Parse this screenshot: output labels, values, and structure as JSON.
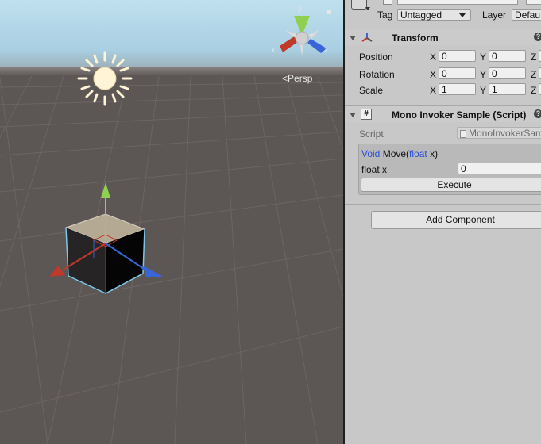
{
  "scene": {
    "gizmo_axis_labels": {
      "y": "y",
      "x": "x",
      "z": "z"
    },
    "persp_label": "Persp",
    "colors": {
      "sky": "#a9cfe2",
      "ground": "#5c5655",
      "x_axis": "#c0392b",
      "y_axis": "#8fd14f",
      "z_axis": "#3866d9"
    }
  },
  "inspector": {
    "tag_label": "Tag",
    "tag_value": "Untagged",
    "layer_label": "Layer",
    "layer_value": "Defau",
    "transform": {
      "title": "Transform",
      "help_glyph": "?",
      "rows": [
        {
          "label": "Position",
          "x_label": "X",
          "x": "0",
          "y_label": "Y",
          "y": "0",
          "z_label": "Z"
        },
        {
          "label": "Rotation",
          "x_label": "X",
          "x": "0",
          "y_label": "Y",
          "y": "0",
          "z_label": "Z"
        },
        {
          "label": "Scale",
          "x_label": "X",
          "x": "1",
          "y_label": "Y",
          "y": "1",
          "z_label": "Z"
        }
      ]
    },
    "component": {
      "title": "Mono Invoker Sample (Script)",
      "icon_glyph": "#",
      "help_glyph": "?",
      "script_label": "Script",
      "script_value": "MonoInvokerSam",
      "method": {
        "return_type": "Void",
        "name": " Move(",
        "param_type": "float",
        "param_name": " x)"
      },
      "param_label": "float x",
      "param_value": "0",
      "execute_label": "Execute"
    },
    "add_component_label": "Add Component"
  }
}
